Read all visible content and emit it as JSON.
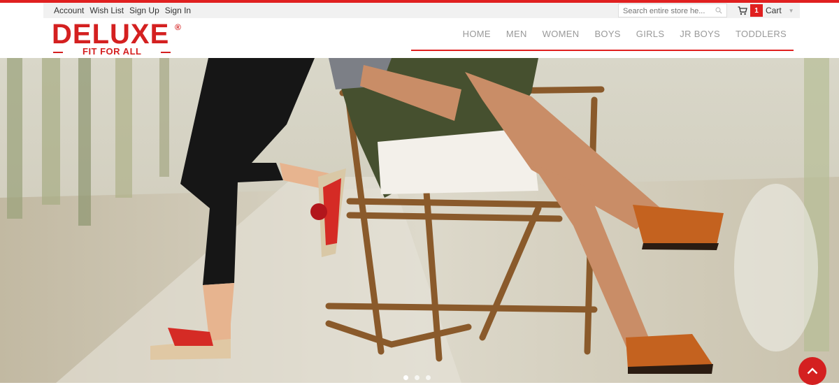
{
  "topbar": {
    "links": [
      "Account",
      "Wish List",
      "Sign Up",
      "Sign In"
    ],
    "search_placeholder": "Search entire store he...",
    "cart_count": "1",
    "cart_label": "Cart"
  },
  "brand": {
    "name": "DELUXE",
    "registered": "®",
    "tagline": "FIT FOR ALL",
    "color": "#d42020"
  },
  "nav": {
    "items": [
      "HOME",
      "MEN",
      "WOMEN",
      "BOYS",
      "GIRLS",
      "JR BOYS",
      "TODDLERS"
    ]
  },
  "carousel": {
    "slides": 3,
    "active_index": 0
  },
  "icons": {
    "search": "search-icon",
    "cart": "cart-icon",
    "back_to_top": "chevron-up-icon"
  }
}
